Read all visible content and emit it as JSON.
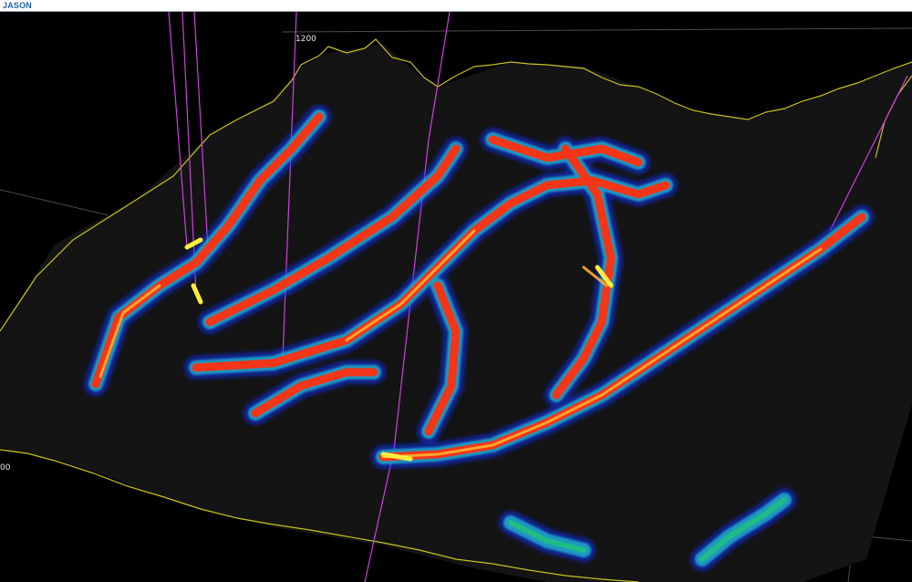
{
  "app": {
    "logo_text": "JASON"
  },
  "view3d": {
    "axis_labels": {
      "top": "1200",
      "left": "00"
    },
    "colors": {
      "background": "#000000",
      "boundary": "#c8c020",
      "well_path": "#d040e0",
      "frame": "#5a5a5a",
      "scale_low": "#1030ff",
      "scale_mid": "#20d0c0",
      "scale_high": "#ff3010",
      "scale_peak": "#ffee40"
    }
  }
}
